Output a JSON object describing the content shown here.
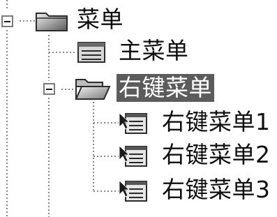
{
  "tree": {
    "root": {
      "label": "菜单",
      "icon": "folder-closed-icon",
      "expanded": true
    },
    "children": [
      {
        "label": "主菜单",
        "icon": "menu-item-icon"
      },
      {
        "label": "右键菜单",
        "icon": "folder-open-icon",
        "expanded": true,
        "selected": true,
        "children": [
          {
            "label": "右键菜单1",
            "icon": "context-menu-icon"
          },
          {
            "label": "右键菜单2",
            "icon": "context-menu-icon"
          },
          {
            "label": "右键菜单3",
            "icon": "context-menu-icon"
          }
        ]
      }
    ]
  },
  "colors": {
    "selection_background": "#5c5c5c",
    "selection_text": "#ffffff",
    "guide_lines": "#888888",
    "text": "#0f0f0f"
  }
}
